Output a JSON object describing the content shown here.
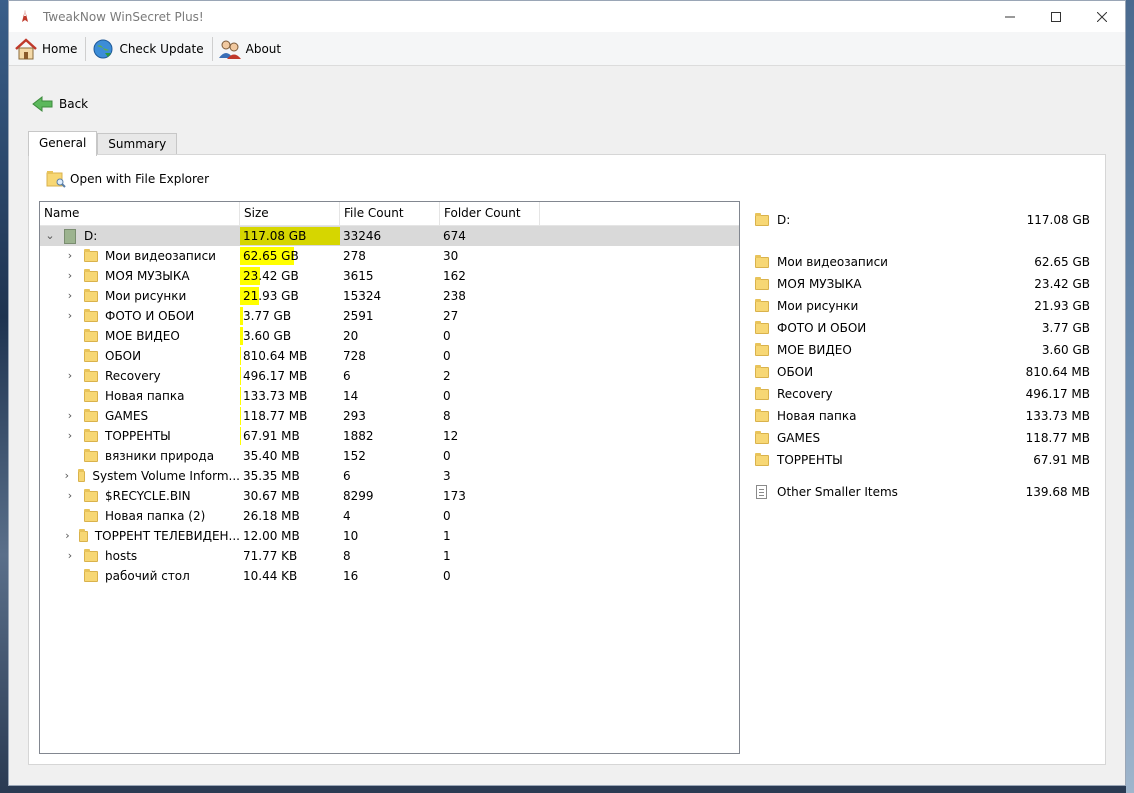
{
  "window": {
    "title": "TweakNow WinSecret Plus!"
  },
  "toolbar": {
    "home": "Home",
    "check_update": "Check Update",
    "about": "About"
  },
  "nav": {
    "back": "Back"
  },
  "tabs": [
    {
      "label": "General"
    },
    {
      "label": "Summary"
    }
  ],
  "actions": {
    "open_explorer": "Open with File Explorer"
  },
  "columns": {
    "name": "Name",
    "size": "Size",
    "file_count": "File Count",
    "folder_count": "Folder Count"
  },
  "rows": [
    {
      "name": "D:",
      "size": "117.08 GB",
      "files": "33246",
      "folders": "674",
      "fraction": 1.0
    },
    {
      "name": "Мои видеозаписи",
      "size": "62.65 GB",
      "files": "278",
      "folders": "30",
      "fraction": 0.535
    },
    {
      "name": "МОЯ МУЗЫКА",
      "size": "23.42 GB",
      "files": "3615",
      "folders": "162",
      "fraction": 0.2
    },
    {
      "name": "Мои рисунки",
      "size": "21.93 GB",
      "files": "15324",
      "folders": "238",
      "fraction": 0.187
    },
    {
      "name": "ФОТО И ОБОИ",
      "size": "3.77 GB",
      "files": "2591",
      "folders": "27",
      "fraction": 0.032
    },
    {
      "name": "МОЕ ВИДЕО",
      "size": "3.60 GB",
      "files": "20",
      "folders": "0",
      "fraction": 0.031
    },
    {
      "name": "ОБОИ",
      "size": "810.64 MB",
      "files": "728",
      "folders": "0",
      "fraction": 0.007
    },
    {
      "name": "Recovery",
      "size": "496.17 MB",
      "files": "6",
      "folders": "2",
      "fraction": 0.004
    },
    {
      "name": "Новая папка",
      "size": "133.73 MB",
      "files": "14",
      "folders": "0",
      "fraction": 0.001
    },
    {
      "name": "GAMES",
      "size": "118.77 MB",
      "files": "293",
      "folders": "8",
      "fraction": 0.001
    },
    {
      "name": "ТОРРЕНТЫ",
      "size": "67.91 MB",
      "files": "1882",
      "folders": "12",
      "fraction": 0.001
    },
    {
      "name": "вязники природа",
      "size": "35.40 MB",
      "files": "152",
      "folders": "0",
      "fraction": 0.0
    },
    {
      "name": "System Volume Inform...",
      "size": "35.35 MB",
      "files": "6",
      "folders": "3",
      "fraction": 0.0
    },
    {
      "name": "$RECYCLE.BIN",
      "size": "30.67 MB",
      "files": "8299",
      "folders": "173",
      "fraction": 0.0
    },
    {
      "name": "Новая папка (2)",
      "size": "26.18 MB",
      "files": "4",
      "folders": "0",
      "fraction": 0.0
    },
    {
      "name": "ТОРРЕНТ ТЕЛЕВИДЕН...",
      "size": "12.00 MB",
      "files": "10",
      "folders": "1",
      "fraction": 0.0
    },
    {
      "name": "hosts",
      "size": "71.77 KB",
      "files": "8",
      "folders": "1",
      "fraction": 0.0
    },
    {
      "name": "рабочий стол",
      "size": "10.44 KB",
      "files": "16",
      "folders": "0",
      "fraction": 0.0
    }
  ],
  "summary": {
    "root": {
      "name": "D:",
      "size": "117.08 GB"
    },
    "items": [
      {
        "name": "Мои видеозаписи",
        "size": "62.65 GB"
      },
      {
        "name": "МОЯ МУЗЫКА",
        "size": "23.42 GB"
      },
      {
        "name": "Мои рисунки",
        "size": "21.93 GB"
      },
      {
        "name": "ФОТО И ОБОИ",
        "size": "3.77 GB"
      },
      {
        "name": "МОЕ ВИДЕО",
        "size": "3.60 GB"
      },
      {
        "name": "ОБОИ",
        "size": "810.64 MB"
      },
      {
        "name": "Recovery",
        "size": "496.17 MB"
      },
      {
        "name": "Новая папка",
        "size": "133.73 MB"
      },
      {
        "name": "GAMES",
        "size": "118.77 MB"
      },
      {
        "name": "ТОРРЕНТЫ",
        "size": "67.91 MB"
      }
    ],
    "other": {
      "name": "Other Smaller Items",
      "size": "139.68 MB"
    }
  },
  "colors": {
    "size_bar": "#ffff00",
    "size_bar_selected": "#d6d600"
  }
}
